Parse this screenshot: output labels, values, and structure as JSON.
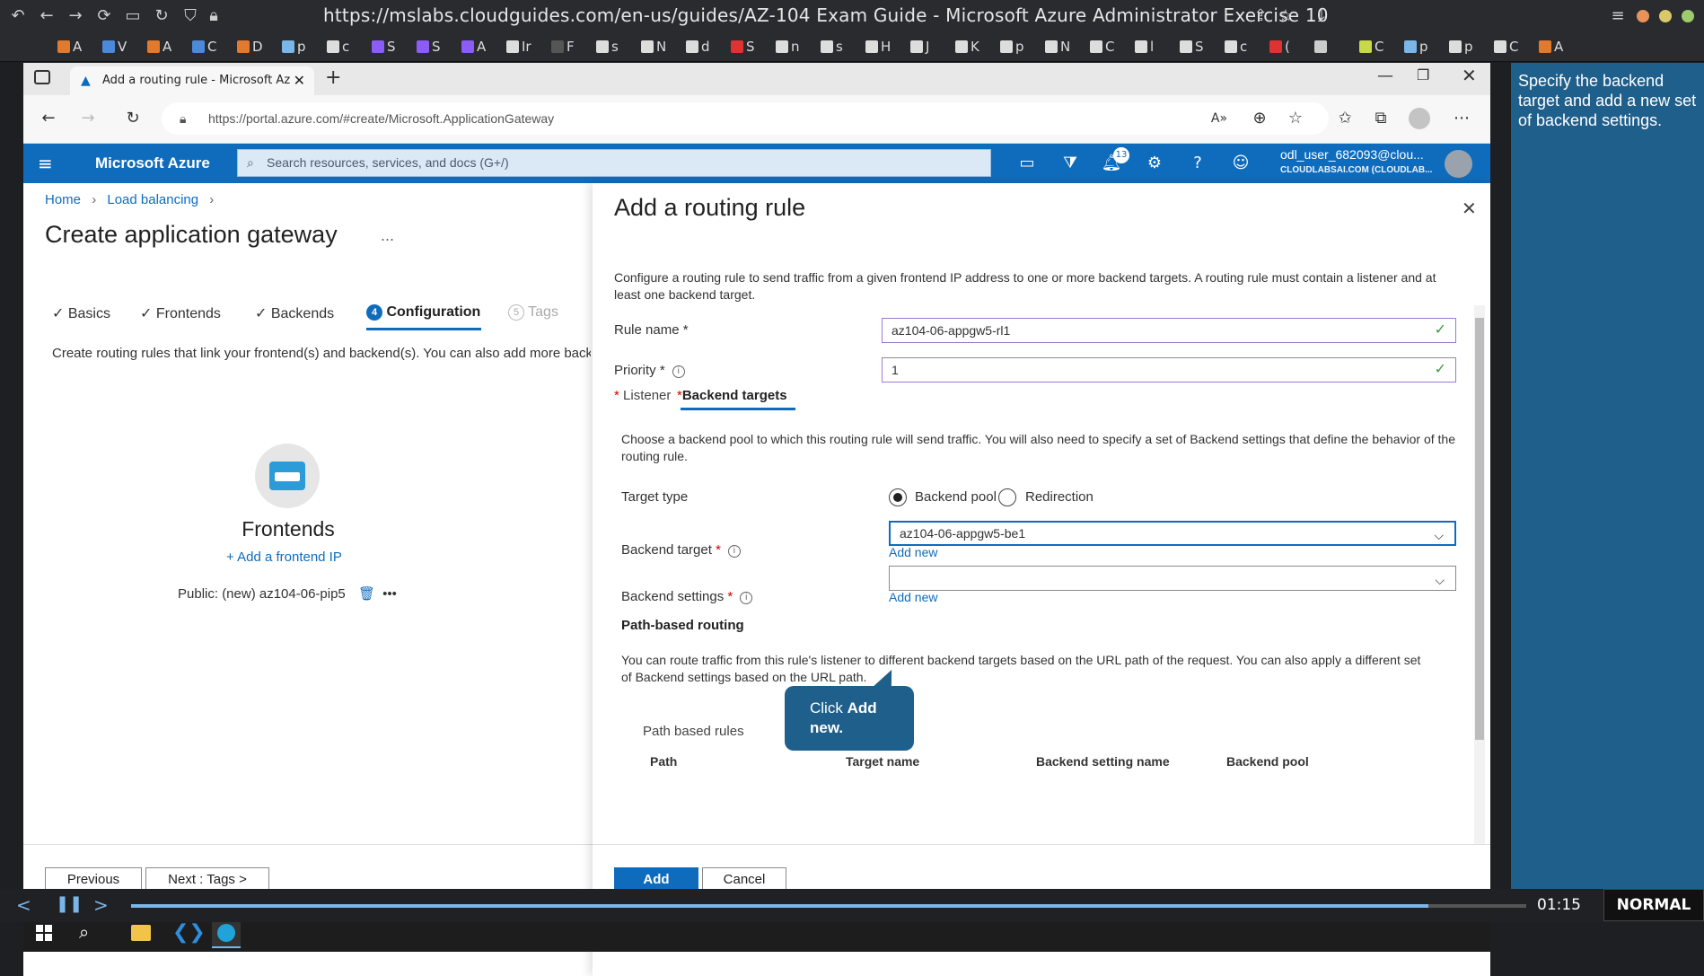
{
  "browser": {
    "url": "https://mslabs.cloudguides.com/en-us/guides/AZ-104 Exam Guide - Microsoft Azure Administrator Exercise 10",
    "bookmarks": [
      "A",
      "V",
      "A",
      "C",
      "D",
      "p",
      "c",
      "S",
      "S",
      "A",
      "Ir",
      "F",
      "s",
      "N",
      "d",
      "S",
      "n",
      "s",
      "H",
      "J",
      "K",
      "p",
      "N",
      "C",
      "l",
      "S",
      "c",
      "(",
      "",
      "C",
      "p",
      "p",
      "C",
      "A"
    ]
  },
  "edge": {
    "tab_title": "Add a routing rule - Microsoft Az",
    "address": "https://portal.azure.com/#create/Microsoft.ApplicationGateway"
  },
  "azure": {
    "brand": "Microsoft Azure",
    "search_placeholder": "Search resources, services, and docs (G+/)",
    "notif_count": "13",
    "user": "odl_user_682093@clou...",
    "org": "CLOUDLABSAI.COM (CLOUDLAB..."
  },
  "left": {
    "breadcrumb": [
      "Home",
      "Load balancing"
    ],
    "title": "Create application gateway",
    "ellipsis": "...",
    "tabs": [
      {
        "label": "Basics",
        "state": "done"
      },
      {
        "label": "Frontends",
        "state": "done"
      },
      {
        "label": "Backends",
        "state": "done"
      },
      {
        "num": "4",
        "label": "Configuration",
        "state": "active"
      },
      {
        "num": "5",
        "label": "Tags",
        "state": "disabled"
      }
    ],
    "description": "Create routing rules that link your frontend(s) and backend(s). You can also add more back",
    "frontends_title": "Frontends",
    "add_frontend": "+ Add a frontend IP",
    "frontend_item": "Public: (new) az104-06-pip5",
    "prev_btn": "Previous",
    "next_btn": "Next : Tags >"
  },
  "panel": {
    "title": "Add a routing rule",
    "intro": "Configure a routing rule to send traffic from a given frontend IP address to one or more backend targets. A routing rule must contain a listener and at least one backend target.",
    "rule_name_label": "Rule name",
    "rule_name_value": "az104-06-appgw5-rl1",
    "priority_label": "Priority",
    "priority_value": "1",
    "tab_listener": "Listener",
    "tab_backend": "Backend targets",
    "backend_desc": "Choose a backend pool to which this routing rule will send traffic. You will also need to specify a set of Backend settings that define the behavior of the routing rule.",
    "target_type_label": "Target type",
    "radio_backend_pool": "Backend pool",
    "radio_redirection": "Redirection",
    "backend_target_label": "Backend target",
    "backend_target_value": "az104-06-appgw5-be1",
    "add_new_1": "Add new",
    "backend_settings_label": "Backend settings",
    "add_new_2": "Add new",
    "path_routing_title": "Path-based routing",
    "path_routing_desc": "You can route traffic from this rule's listener to different backend targets based on the URL path of the request. You can also apply a different set of Backend settings based on the URL path.",
    "path_rules_title": "Path based rules",
    "col_path": "Path",
    "col_target": "Target name",
    "col_setting": "Backend setting name",
    "col_pool": "Backend pool",
    "add_btn": "Add",
    "cancel_btn": "Cancel"
  },
  "tooltip": {
    "line1": "Click ",
    "bold": "Add",
    "line2": "new."
  },
  "side_instruction": "Specify the backend target and add a new set of backend settings.",
  "player": {
    "time": "01:15",
    "mode": "NORMAL",
    "progress": 0.93
  }
}
